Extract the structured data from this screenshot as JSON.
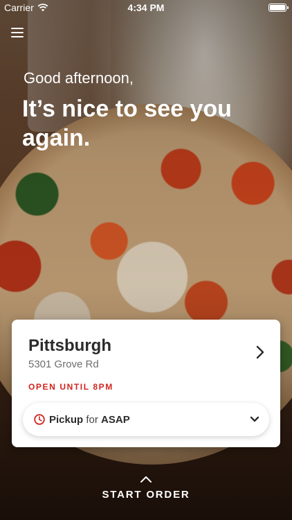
{
  "status_bar": {
    "carrier": "Carrier",
    "time": "4:34 PM",
    "wifi_icon": "wifi-icon",
    "battery_icon": "battery-icon"
  },
  "menu": {
    "icon": "hamburger-menu-icon"
  },
  "greeting": "Good afternoon,",
  "headline": "It’s nice to see you again.",
  "location_card": {
    "store_name": "Pittsburgh",
    "address": "5301 Grove Rd",
    "hours": "OPEN UNTIL 8PM",
    "chevron_icon": "chevron-right-icon"
  },
  "order_selector": {
    "clock_icon": "clock-icon",
    "method": "Pickup",
    "connector": "for",
    "time": "ASAP",
    "dropdown_icon": "chevron-down-icon"
  },
  "start_order": {
    "label": "START ORDER",
    "icon": "chevron-up-icon"
  },
  "colors": {
    "accent_red": "#d0241c",
    "text_dark": "#2b2b2b",
    "text_muted": "#6e6e6e"
  }
}
